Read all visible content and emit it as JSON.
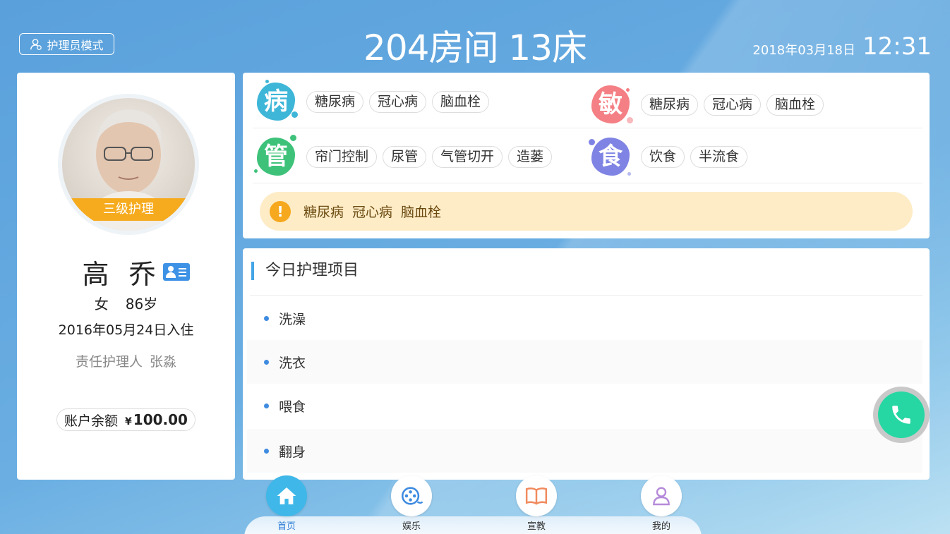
{
  "header": {
    "mode_label": "护理员模式",
    "room_title": "204房间 13床",
    "date": "2018年03月18日",
    "time": "12:31"
  },
  "profile": {
    "care_level": "三级护理",
    "name": "高乔",
    "gender": "女",
    "age": "86岁",
    "checkin": "2016年05月24日入住",
    "nurse_label": "责任护理人",
    "nurse_name": "张淼",
    "balance_label": "账户余额",
    "currency": "¥",
    "balance_value": "100.00"
  },
  "tags": {
    "disease": {
      "badge": "病",
      "color": "#3eb6d8",
      "items": [
        "糖尿病",
        "冠心病",
        "脑血栓"
      ]
    },
    "allergy": {
      "badge": "敏",
      "color": "#f47f84",
      "items": [
        "糖尿病",
        "冠心病",
        "脑血栓"
      ]
    },
    "tube": {
      "badge": "管",
      "color": "#3ec27a",
      "items": [
        "帘门控制",
        "尿管",
        "气管切开",
        "造蒌"
      ]
    },
    "diet": {
      "badge": "食",
      "color": "#7f84e4",
      "items": [
        "饮食",
        "半流食"
      ]
    },
    "alert": {
      "icon": "!",
      "items": [
        "糖尿病",
        "冠心病",
        "脑血栓"
      ]
    }
  },
  "today": {
    "title": "今日护理项目",
    "tasks": [
      "洗澡",
      "洗衣",
      "喂食",
      "翻身"
    ]
  },
  "nav": {
    "items": [
      {
        "label": "首页",
        "icon": "home-icon",
        "active": true
      },
      {
        "label": "娱乐",
        "icon": "film-reel-icon",
        "active": false
      },
      {
        "label": "宣教",
        "icon": "book-icon",
        "active": false
      },
      {
        "label": "我的",
        "icon": "user-icon",
        "active": false
      }
    ]
  },
  "colors": {
    "accent_blue": "#3e92e6",
    "care_level": "#f6ab1e",
    "alert_bg": "#feecc7",
    "call_green": "#26d7a3"
  }
}
